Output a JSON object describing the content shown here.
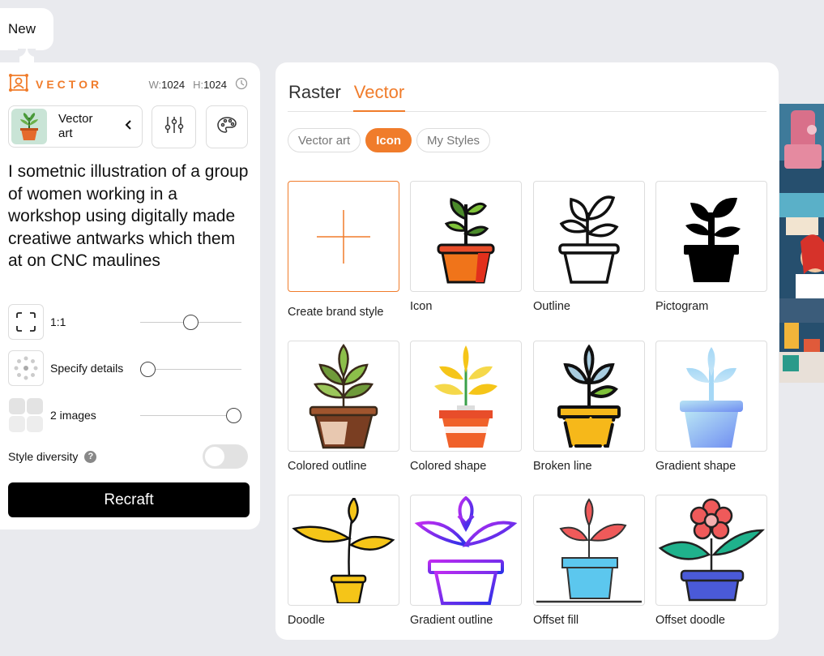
{
  "new_button": "New",
  "left_panel": {
    "brand": "VECTOR",
    "width_key": "W:",
    "width_value": "1024",
    "height_key": "H:",
    "height_value": "1024",
    "style_name": "Vector art",
    "prompt": "I sometnic illustration of a group of women working in a workshop using digitally made creatiwe antwarks which them at on CNC maulines",
    "aspect_label": "1:1",
    "details_label": "Specify details",
    "images_label": "2 images",
    "diversity_label": "Style diversity",
    "diversity_help": "?",
    "recraft_label": "Recraft",
    "sliders": {
      "aspect": 0.5,
      "details": 0.0,
      "images": 1.0
    }
  },
  "main": {
    "tabs": [
      {
        "label": "Raster",
        "active": false
      },
      {
        "label": "Vector",
        "active": true
      }
    ],
    "chips": [
      {
        "label": "Vector art",
        "active": false
      },
      {
        "label": "Icon",
        "active": true
      },
      {
        "label": "My Styles",
        "active": false
      }
    ],
    "styles": [
      {
        "label": "Create brand style",
        "icon": "plus-icon"
      },
      {
        "label": "Icon",
        "icon": "plant-icon"
      },
      {
        "label": "Outline",
        "icon": "plant-outline-icon"
      },
      {
        "label": "Pictogram",
        "icon": "plant-pictogram-icon"
      },
      {
        "label": "Colored outline",
        "icon": "plant-colored-outline-icon"
      },
      {
        "label": "Colored shape",
        "icon": "plant-colored-shape-icon"
      },
      {
        "label": "Broken line",
        "icon": "plant-broken-line-icon"
      },
      {
        "label": "Gradient shape",
        "icon": "plant-gradient-shape-icon"
      },
      {
        "label": "Doodle",
        "icon": "plant-doodle-icon"
      },
      {
        "label": "Gradient outline",
        "icon": "plant-gradient-outline-icon"
      },
      {
        "label": "Offset fill",
        "icon": "plant-offset-fill-icon"
      },
      {
        "label": "Offset doodle",
        "icon": "flower-offset-doodle-icon"
      }
    ]
  },
  "colors": {
    "accent": "#f07c2b",
    "button": "#000000",
    "background": "#e9eaee"
  }
}
